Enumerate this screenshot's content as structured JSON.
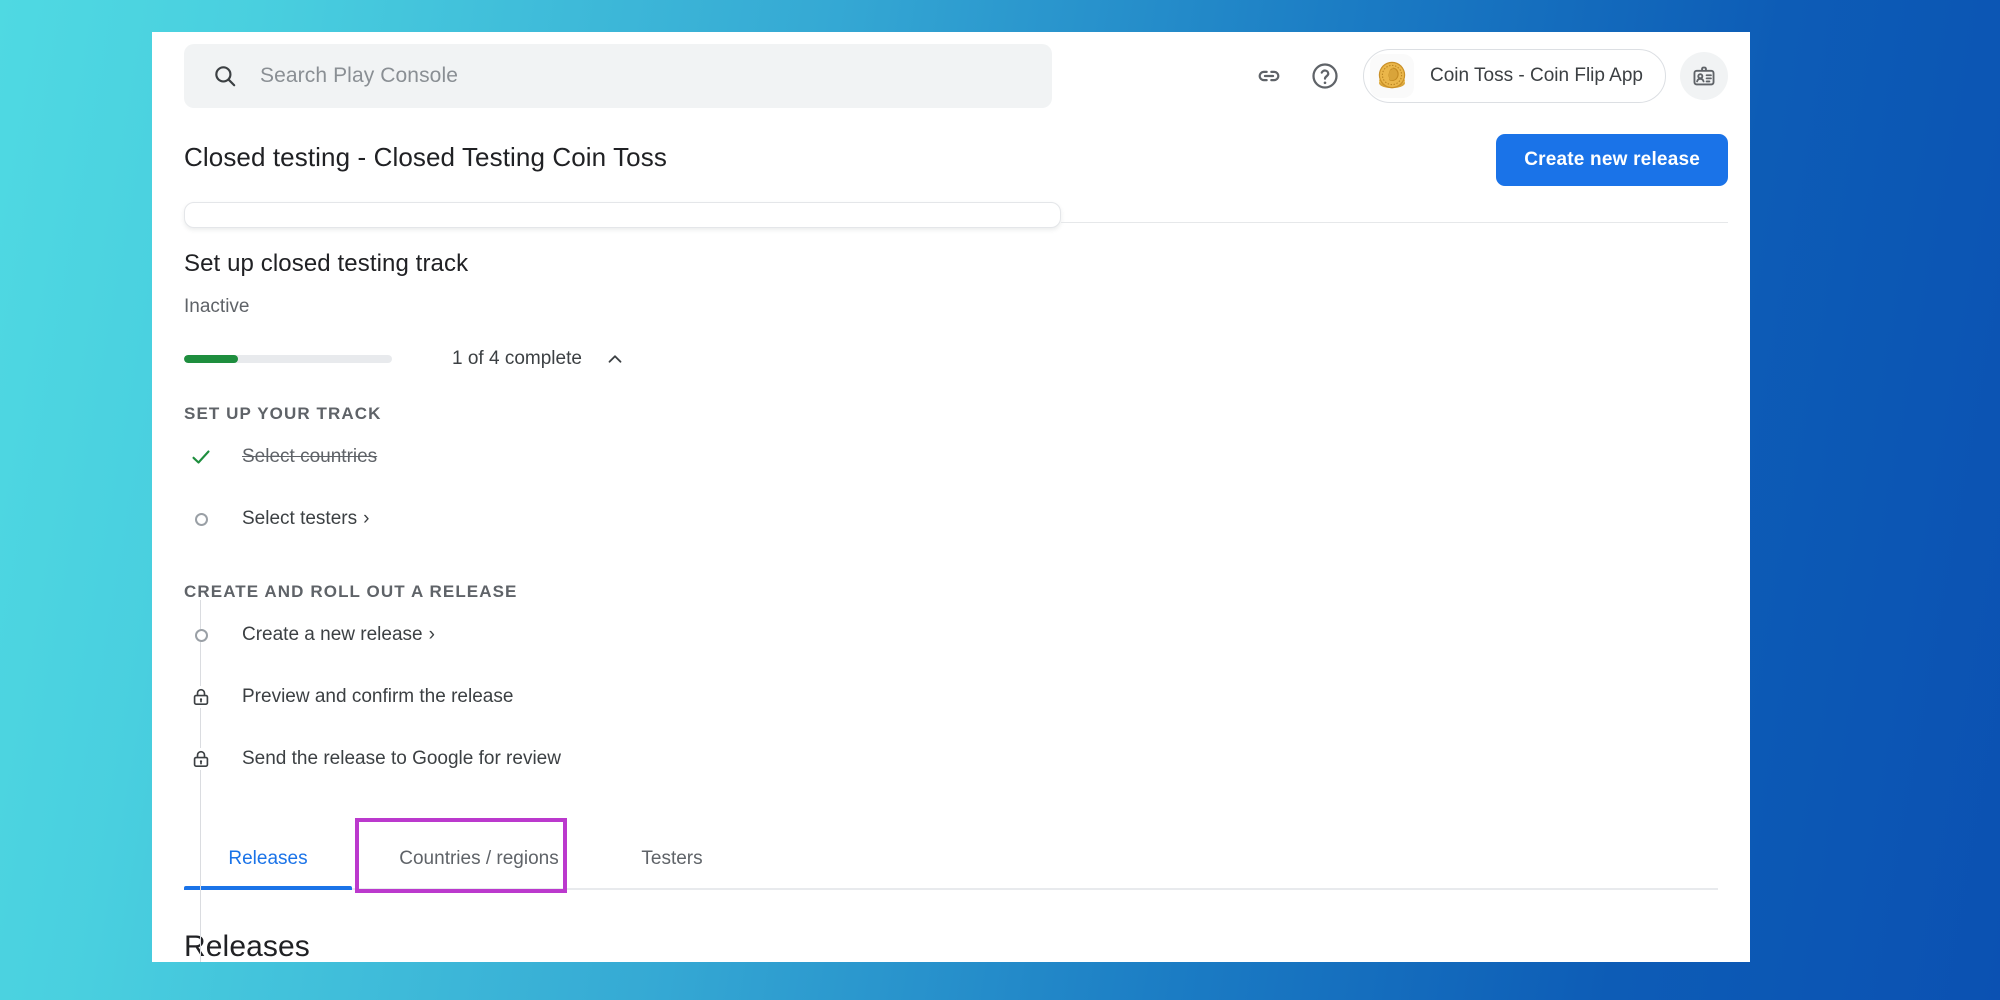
{
  "header": {
    "search": {
      "placeholder": "Search Play Console",
      "icon": "search-icon",
      "value": ""
    },
    "icons": {
      "link": "link-icon",
      "help": "help-circle-icon",
      "badge": "id-badge-icon"
    },
    "account": {
      "name": "Coin Toss - Coin Flip App",
      "avatar": "coin-avatar"
    }
  },
  "page": {
    "title": "Closed testing - Closed Testing Coin Toss",
    "primary_action": "Create new release"
  },
  "setup": {
    "title": "Set up closed testing track",
    "status": "Inactive",
    "progress": {
      "label": "1 of 4 complete",
      "completed": 1,
      "total": 4,
      "percent": 25,
      "fill_color": "#1e8e3e",
      "track_color": "#e8eaed",
      "collapse_icon": "chevron-up-icon"
    },
    "groups": [
      {
        "heading": "SET UP YOUR TRACK",
        "items": [
          {
            "label": "Select countries",
            "state": "complete",
            "marker": "check-icon",
            "chevron": ""
          },
          {
            "label": "Select testers",
            "state": "todo",
            "marker": "circle-icon",
            "chevron": "›"
          }
        ]
      },
      {
        "heading": "CREATE AND ROLL OUT A RELEASE",
        "items": [
          {
            "label": "Create a new release",
            "state": "todo",
            "marker": "circle-icon",
            "chevron": "›"
          },
          {
            "label": "Preview and confirm the release",
            "state": "locked",
            "marker": "lock-icon",
            "chevron": ""
          },
          {
            "label": "Send the release to Google for review",
            "state": "locked",
            "marker": "lock-icon",
            "chevron": ""
          }
        ]
      }
    ]
  },
  "tabs": [
    {
      "label": "Releases",
      "active": true
    },
    {
      "label": "Countries / regions",
      "active": false
    },
    {
      "label": "Testers",
      "active": false
    }
  ],
  "content": {
    "section_heading": "Releases"
  },
  "annotation": {
    "target": "Countries / regions",
    "color": "#bb39cd"
  },
  "colors": {
    "accent_blue": "#1a73e8",
    "success_green": "#1e8e3e",
    "annotation_magenta": "#bb39cd",
    "bg_gradient_start": "#4fd9e2",
    "bg_gradient_end": "#0b51b2"
  }
}
